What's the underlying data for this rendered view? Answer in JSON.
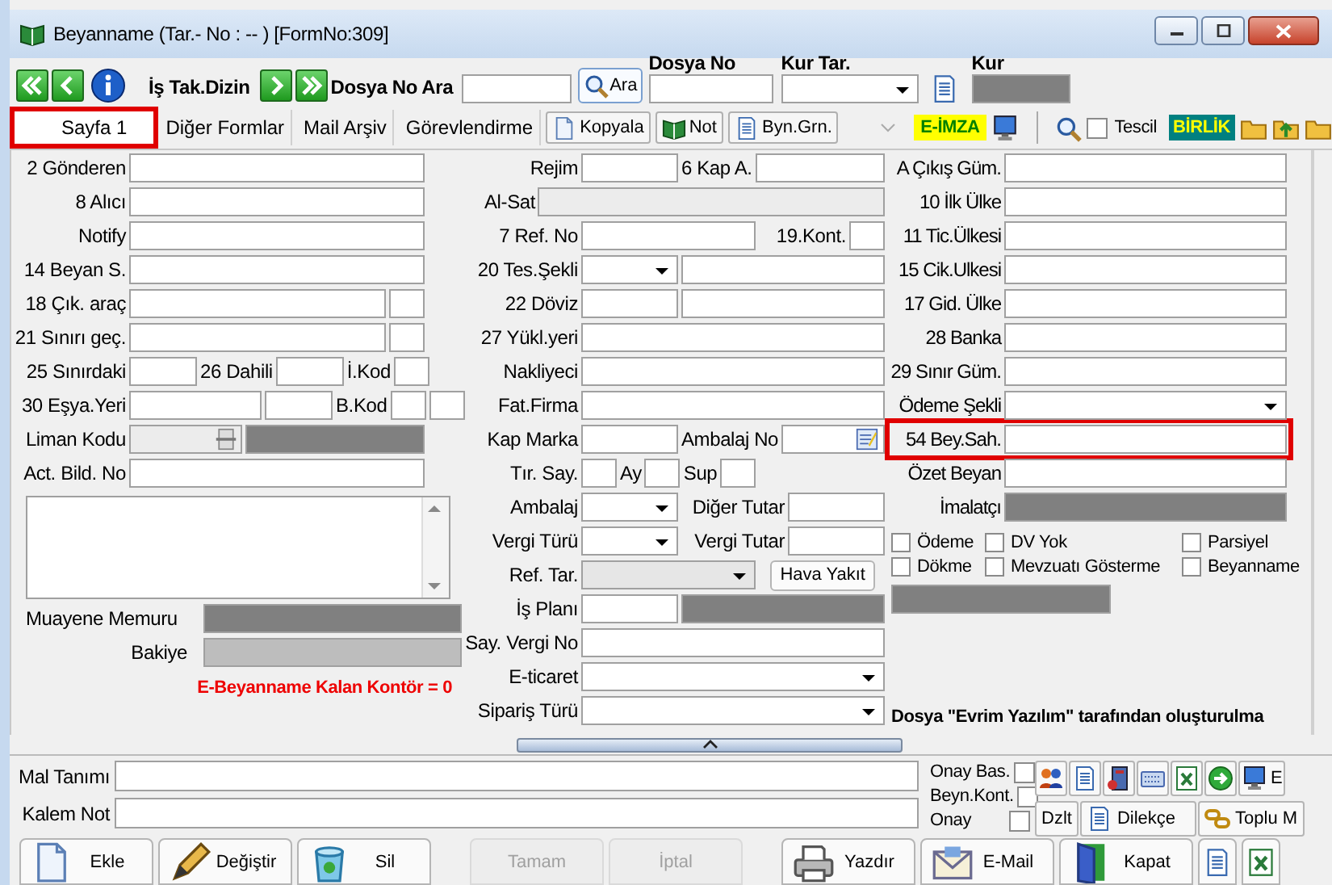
{
  "window": {
    "title": "Beyanname (Tar.- No :  -- )  [FormNo:309]"
  },
  "toolbar": {
    "nav_label": "İş Tak.Dizin",
    "search_label": "Dosya No Ara",
    "search_button": "Ara",
    "dosya_no_label": "Dosya No",
    "kur_tar_label": "Kur Tar.",
    "kur_label": "Kur"
  },
  "tabs": [
    {
      "label": "Sayfa 1",
      "selected": true,
      "highlighted": true
    },
    {
      "label": "Diğer Formlar",
      "selected": false,
      "highlighted": false
    },
    {
      "label": "Mail Arşiv",
      "selected": false,
      "highlighted": false
    },
    {
      "label": "Görevlendirme",
      "selected": false,
      "highlighted": false
    }
  ],
  "tab_tools": [
    "Kopyala",
    "Not",
    "Byn.Grn."
  ],
  "esign": "E-İMZA",
  "tescil": {
    "label": "Tescil",
    "checked": false
  },
  "birlik": "BİRLİK",
  "left": [
    {
      "parts": [
        {
          "kind": "label",
          "text": "2 Gönderen"
        },
        {
          "kind": "text"
        }
      ]
    },
    {
      "parts": [
        {
          "kind": "label",
          "text": "8 Alıcı"
        },
        {
          "kind": "text"
        }
      ]
    },
    {
      "parts": [
        {
          "kind": "label",
          "text": "Notify"
        },
        {
          "kind": "text"
        }
      ]
    },
    {
      "parts": [
        {
          "kind": "label",
          "text": "14 Beyan S."
        },
        {
          "kind": "text"
        }
      ]
    },
    {
      "parts": [
        {
          "kind": "label",
          "text": "18 Çık. araç"
        },
        {
          "kind": "text"
        },
        {
          "kind": "tiny"
        }
      ]
    },
    {
      "parts": [
        {
          "kind": "label",
          "text": "21 Sınırı geç."
        },
        {
          "kind": "text"
        },
        {
          "kind": "tiny"
        }
      ]
    },
    {
      "parts": [
        {
          "kind": "label",
          "text": "25 Sınırdaki"
        },
        {
          "kind": "short"
        },
        {
          "kind": "label",
          "text": "26 Dahili"
        },
        {
          "kind": "short"
        },
        {
          "kind": "label",
          "text": "İ.Kod"
        },
        {
          "kind": "tiny"
        }
      ]
    },
    {
      "parts": [
        {
          "kind": "label",
          "text": "30 Eşya.Yeri"
        },
        {
          "kind": "medium"
        },
        {
          "kind": "short"
        },
        {
          "kind": "label",
          "text": "B.Kod"
        },
        {
          "kind": "tiny"
        },
        {
          "kind": "tiny"
        }
      ]
    },
    {
      "parts": [
        {
          "kind": "label",
          "text": "Liman Kodu"
        },
        {
          "kind": "lookup"
        },
        {
          "kind": "gray"
        }
      ]
    },
    {
      "parts": [
        {
          "kind": "label",
          "text": "Act. Bild. No"
        },
        {
          "kind": "text"
        }
      ]
    }
  ],
  "muayene_label": "Muayene Memuru",
  "bakiye_label": "Bakiye",
  "notice": "E-Beyanname Kalan Kontör = 0",
  "middle": [
    {
      "parts": [
        {
          "kind": "label",
          "text": "Rejim"
        },
        {
          "kind": "short"
        },
        {
          "kind": "label",
          "text": "6 Kap A."
        },
        {
          "kind": "text"
        }
      ]
    },
    {
      "parts": [
        {
          "kind": "label-right",
          "text": "Al-Sat"
        },
        {
          "kind": "shaded"
        }
      ]
    },
    {
      "parts": [
        {
          "kind": "label",
          "text": "7 Ref. No"
        },
        {
          "kind": "medium"
        },
        {
          "kind": "label-right",
          "text": "19.Kont."
        },
        {
          "kind": "tiny"
        }
      ]
    },
    {
      "parts": [
        {
          "kind": "label",
          "text": "20 Tes.Şekli"
        },
        {
          "kind": "combo-short"
        },
        {
          "kind": "text"
        }
      ]
    },
    {
      "parts": [
        {
          "kind": "label",
          "text": "22 Döviz"
        },
        {
          "kind": "short"
        },
        {
          "kind": "text"
        }
      ]
    },
    {
      "parts": [
        {
          "kind": "label",
          "text": "27 Yükl.yeri"
        },
        {
          "kind": "text"
        }
      ]
    },
    {
      "parts": [
        {
          "kind": "label",
          "text": "Nakliyeci"
        },
        {
          "kind": "text"
        }
      ]
    },
    {
      "parts": [
        {
          "kind": "label",
          "text": "Fat.Firma"
        },
        {
          "kind": "text"
        }
      ]
    },
    {
      "parts": [
        {
          "kind": "label",
          "text": "Kap Marka"
        },
        {
          "kind": "short"
        },
        {
          "kind": "label",
          "text": "Ambalaj No"
        },
        {
          "kind": "note-field"
        }
      ]
    },
    {
      "parts": [
        {
          "kind": "label",
          "text": "Tır. Say."
        },
        {
          "kind": "tiny"
        },
        {
          "kind": "label",
          "text": "Ay"
        },
        {
          "kind": "tiny"
        },
        {
          "kind": "label",
          "text": "Sup"
        },
        {
          "kind": "tiny"
        }
      ]
    },
    {
      "parts": [
        {
          "kind": "label",
          "text": "Ambalaj"
        },
        {
          "kind": "combo-short"
        },
        {
          "kind": "label-right",
          "text": "Diğer Tutar"
        },
        {
          "kind": "short"
        }
      ]
    },
    {
      "parts": [
        {
          "kind": "label",
          "text": "Vergi Türü"
        },
        {
          "kind": "combo-short"
        },
        {
          "kind": "label-right",
          "text": "Vergi Tutar"
        },
        {
          "kind": "short"
        }
      ]
    },
    {
      "parts": [
        {
          "kind": "label",
          "text": "Ref. Tar."
        },
        {
          "kind": "combo-disabled"
        },
        {
          "kind": "button",
          "text": "Hava Yakıt"
        }
      ]
    },
    {
      "parts": [
        {
          "kind": "label",
          "text": "İş Planı"
        },
        {
          "kind": "short"
        },
        {
          "kind": "gray"
        }
      ]
    },
    {
      "parts": [
        {
          "kind": "label",
          "text": "Say. Vergi No"
        },
        {
          "kind": "text"
        }
      ]
    },
    {
      "parts": [
        {
          "kind": "label",
          "text": "E-ticaret"
        },
        {
          "kind": "combo"
        }
      ]
    },
    {
      "parts": [
        {
          "kind": "label",
          "text": "Sipariş Türü"
        },
        {
          "kind": "combo"
        }
      ]
    }
  ],
  "right": [
    {
      "highlighted": false,
      "parts": [
        {
          "kind": "label",
          "text": "A Çıkış Güm."
        },
        {
          "kind": "text"
        }
      ]
    },
    {
      "highlighted": false,
      "parts": [
        {
          "kind": "label",
          "text": "10 İlk Ülke"
        },
        {
          "kind": "text"
        }
      ]
    },
    {
      "highlighted": false,
      "parts": [
        {
          "kind": "label",
          "text": "11 Tic.Ülkesi"
        },
        {
          "kind": "text"
        }
      ]
    },
    {
      "highlighted": false,
      "parts": [
        {
          "kind": "label",
          "text": "15 Cik.Ulkesi"
        },
        {
          "kind": "text"
        }
      ]
    },
    {
      "highlighted": false,
      "parts": [
        {
          "kind": "label",
          "text": "17 Gid. Ülke"
        },
        {
          "kind": "text"
        }
      ]
    },
    {
      "highlighted": false,
      "parts": [
        {
          "kind": "label",
          "text": "28 Banka"
        },
        {
          "kind": "text"
        }
      ]
    },
    {
      "highlighted": false,
      "parts": [
        {
          "kind": "label",
          "text": "29 Sınır Güm."
        },
        {
          "kind": "text"
        }
      ]
    },
    {
      "highlighted": false,
      "parts": [
        {
          "kind": "label",
          "text": "Ödeme Şekli"
        },
        {
          "kind": "combo"
        }
      ]
    },
    {
      "highlighted": true,
      "parts": [
        {
          "kind": "label",
          "text": "54 Bey.Sah."
        },
        {
          "kind": "text"
        }
      ]
    },
    {
      "highlighted": false,
      "parts": [
        {
          "kind": "label",
          "text": "Özet Beyan"
        },
        {
          "kind": "text"
        }
      ]
    },
    {
      "highlighted": false,
      "parts": [
        {
          "kind": "label",
          "text": "İmalatçı"
        },
        {
          "kind": "gray"
        }
      ]
    }
  ],
  "options": [
    {
      "label": "Ödeme",
      "checked": false
    },
    {
      "label": "DV Yok",
      "checked": false
    },
    {
      "label": "Parsiyel",
      "checked": false
    },
    {
      "label": "Dökme",
      "checked": false
    },
    {
      "label": "Mevzuatı Gösterme",
      "checked": false
    },
    {
      "label": "Beyanname",
      "checked": false
    }
  ],
  "footer_note": "Dosya \"Evrim Yazılım\" tarafından oluşturulma",
  "bottom": {
    "mal_label": "Mal Tanımı",
    "kalem_label": "Kalem Not",
    "approvals": [
      {
        "label": "Onay Bas.",
        "checked": false
      },
      {
        "label": "Beyn.Kont.",
        "checked": false
      },
      {
        "label": "Onay",
        "checked": false
      }
    ],
    "cut_button": "E",
    "side_buttons": [
      "Dzlt",
      "Dilekçe",
      "Toplu M"
    ]
  },
  "actions": [
    {
      "label": "Ekle",
      "disabled": false
    },
    {
      "label": "Değiştir",
      "disabled": false
    },
    {
      "label": "Sil",
      "disabled": false
    },
    {
      "label": "Tamam",
      "disabled": true
    },
    {
      "label": "İptal",
      "disabled": true
    },
    {
      "label": "Yazdır",
      "disabled": false
    },
    {
      "label": "E-Mail",
      "disabled": false
    },
    {
      "label": "Kapat",
      "disabled": false
    }
  ]
}
